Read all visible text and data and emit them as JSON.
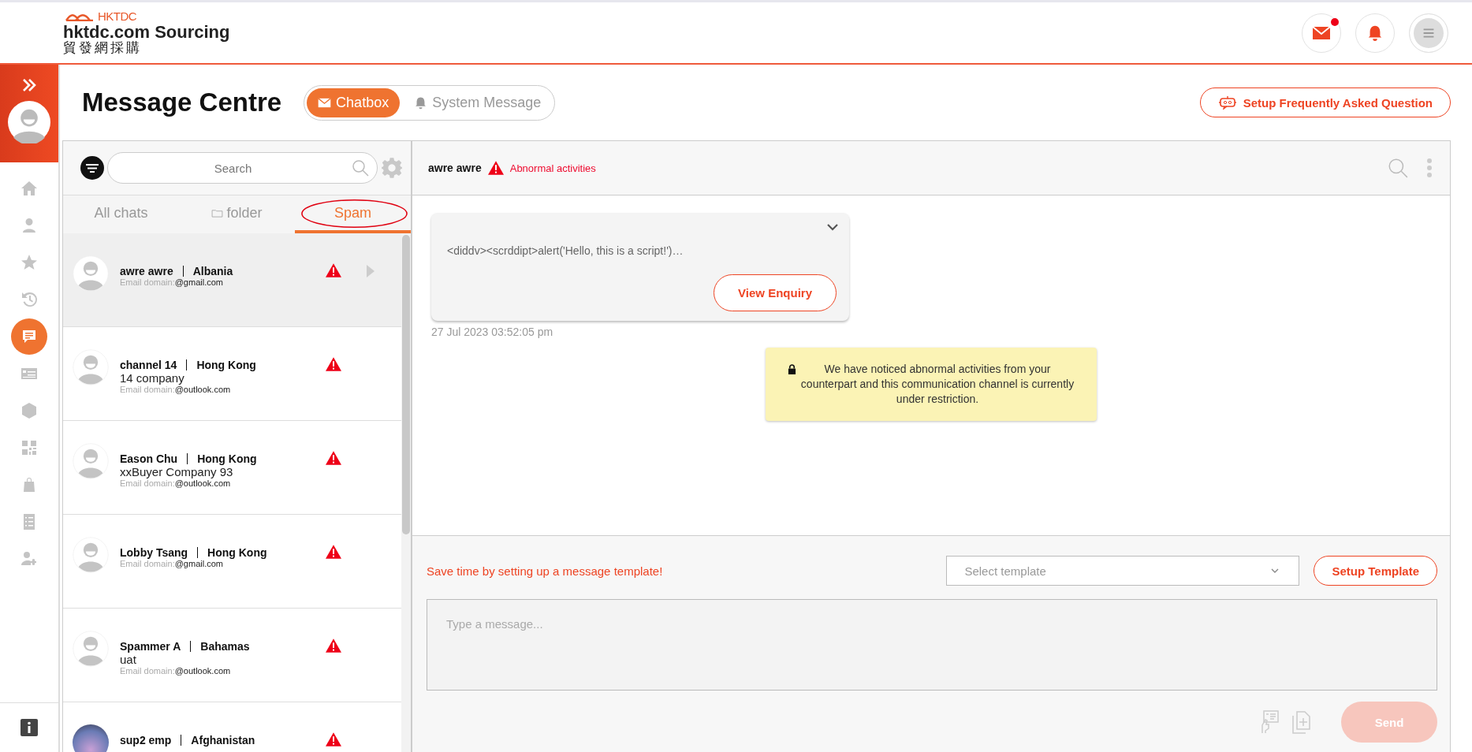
{
  "header": {
    "brand_mark": "HKTDC",
    "brand": "hktdc.com Sourcing",
    "brand_chinese": "貿發網採購",
    "actions": [
      {
        "kind": "mail",
        "unread": true
      },
      {
        "kind": "bell"
      },
      {
        "kind": "menu"
      }
    ]
  },
  "sidebar": {
    "items": [
      {
        "kind": "home",
        "selected": false
      },
      {
        "kind": "person",
        "selected": false
      },
      {
        "kind": "star",
        "selected": false
      },
      {
        "kind": "history",
        "selected": false
      },
      {
        "kind": "chat",
        "selected": true
      },
      {
        "kind": "card",
        "selected": false
      },
      {
        "kind": "cube",
        "selected": false
      },
      {
        "kind": "qr",
        "selected": false
      },
      {
        "kind": "bag",
        "selected": false
      },
      {
        "kind": "checklist",
        "selected": false
      },
      {
        "kind": "user-gear",
        "selected": false
      }
    ]
  },
  "page": {
    "title": "Message Centre",
    "views": [
      {
        "label": "Chatbox",
        "kind": "mail",
        "selected": true
      },
      {
        "label": "System Message",
        "kind": "bell",
        "selected": false
      }
    ],
    "faq_button": "Setup Frequently Asked Question"
  },
  "contacts": {
    "search": {
      "placeholder": "Search"
    },
    "tabs": [
      {
        "label": "All chats",
        "kind": "plain",
        "selected": false,
        "circled": false
      },
      {
        "label": "folder",
        "kind": "folder",
        "selected": false,
        "circled": false
      },
      {
        "label": "Spam",
        "kind": "plain",
        "selected": true,
        "circled": true
      }
    ],
    "items": [
      {
        "name": "awre awre",
        "country": "Albania",
        "email_label": "Email domain:",
        "email": "@gmail.com",
        "photo": false,
        "selected": true,
        "warning": true
      },
      {
        "name": "channel 14",
        "country": "Hong Kong",
        "company": "14 company",
        "email_label": "Email domain:",
        "email": "@outlook.com",
        "photo": false,
        "selected": false,
        "warning": true
      },
      {
        "name": "Eason Chu",
        "country": "Hong Kong",
        "company": "xxBuyer Company 93",
        "email_label": "Email domain:",
        "email": "@outlook.com",
        "photo": false,
        "selected": false,
        "warning": true
      },
      {
        "name": "Lobby Tsang",
        "country": "Hong Kong",
        "email_label": "Email domain:",
        "email": "@gmail.com",
        "photo": false,
        "selected": false,
        "warning": true
      },
      {
        "name": "Spammer A",
        "country": "Bahamas",
        "company": "uat",
        "email_label": "Email domain:",
        "email": "@outlook.com",
        "photo": false,
        "selected": false,
        "warning": true
      },
      {
        "name": "sup2 emp",
        "country": "Afghanistan",
        "photo": true,
        "selected": false,
        "warning": true
      }
    ]
  },
  "chat": {
    "name": "awre awre",
    "status": "Abnormal activities",
    "messages": [
      {
        "kind": "enquiry",
        "text": "<diddv><scrddipt>alert('Hello, this is a script!')…",
        "button": "View Enquiry",
        "time": "27 Jul 2023 03:52:05 pm"
      },
      {
        "kind": "notice",
        "text": "We have noticed abnormal activities from your counterpart and this communication channel is currently under restriction."
      }
    ],
    "composer": {
      "hint": "Save time by setting up a message template!",
      "template_placeholder": "Select template",
      "template_button": "Setup Template",
      "message_placeholder": "Type a message...",
      "send": "Send",
      "send_disabled": true
    }
  }
}
